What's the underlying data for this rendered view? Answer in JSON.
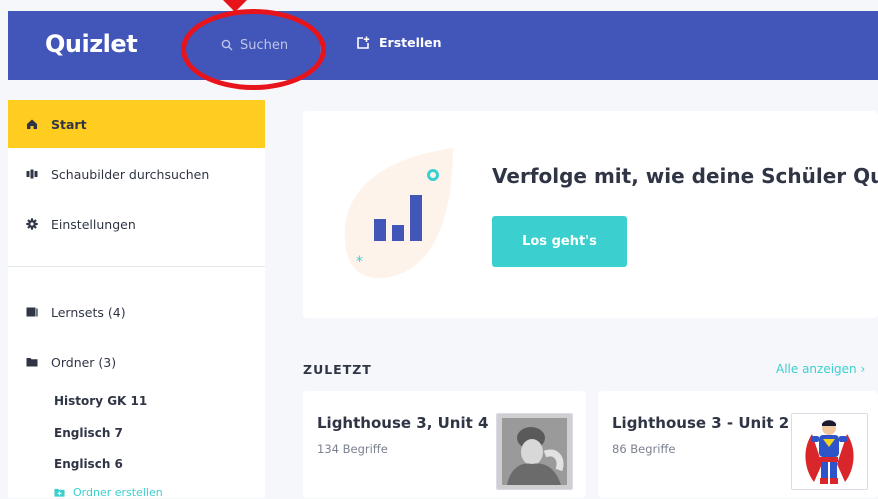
{
  "header": {
    "logo": "Quizlet",
    "search_placeholder": "Suchen",
    "create_label": "Erstellen"
  },
  "sidebar": {
    "items": [
      {
        "label": "Start",
        "icon": "home-icon"
      },
      {
        "label": "Schaubilder durchsuchen",
        "icon": "diagrams-icon"
      },
      {
        "label": "Einstellungen",
        "icon": "gear-icon"
      }
    ],
    "library": [
      {
        "label": "Lernsets (4)",
        "icon": "sets-icon"
      },
      {
        "label": "Ordner (3)",
        "icon": "folder-icon"
      }
    ],
    "folders": [
      "History GK 11",
      "Englisch 7",
      "Englisch 6"
    ],
    "create_folder": "Ordner erstellen"
  },
  "promo": {
    "title": "Verfolge mit, wie deine Schüler Quiz",
    "button": "Los geht's"
  },
  "recent": {
    "heading": "ZULETZT",
    "see_all": "Alle anzeigen",
    "sets": [
      {
        "title": "Lighthouse 3, Unit 4",
        "count": "134 Begriffe"
      },
      {
        "title": "Lighthouse 3 - Unit 2",
        "count": "86 Begriffe"
      }
    ]
  },
  "colors": {
    "header": "#4255b8",
    "active": "#ffcd1f",
    "accent": "#3ccfcf",
    "annotation": "#e8141b"
  }
}
